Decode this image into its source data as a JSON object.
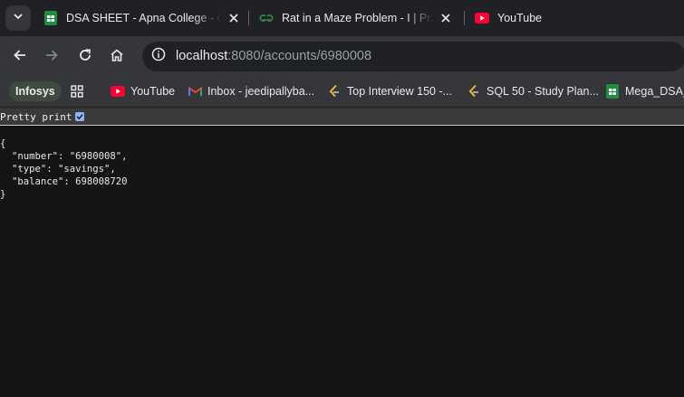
{
  "tabs": [
    {
      "title": "DSA SHEET - Apna College - Go",
      "icon": "google-sheets-icon"
    },
    {
      "title": "Rat in a Maze Problem - I | Prac",
      "icon": "geeksforgeeks-icon"
    },
    {
      "title": "YouTube",
      "icon": "youtube-icon"
    }
  ],
  "address_bar": {
    "host": "localhost",
    "path": ":8080/accounts/6980008"
  },
  "bookmarks": [
    {
      "label": "Infosys",
      "icon": "none"
    },
    {
      "label": "",
      "icon": "apps-grid-icon"
    },
    {
      "label": "YouTube",
      "icon": "youtube-icon"
    },
    {
      "label": "Inbox - jeedipallyba...",
      "icon": "gmail-icon"
    },
    {
      "label": "Top Interview 150 -...",
      "icon": "leetcode-icon"
    },
    {
      "label": "SQL 50 - Study Plan...",
      "icon": "leetcode-icon"
    },
    {
      "label": "Mega_DSA_",
      "icon": "google-sheets-icon"
    }
  ],
  "pretty_print": {
    "label": "Pretty print",
    "checked": true
  },
  "json_lines": {
    "open": "{",
    "number": "\"number\": \"6980008\",",
    "type": "\"type\": \"savings\",",
    "balance": "\"balance\": 698008720",
    "close": "}"
  },
  "colors": {
    "accent": "#8ab4f8",
    "youtube_red": "#ff0033",
    "sheets_green": "#1e8e3e",
    "gfg_green": "#2f8d46"
  }
}
